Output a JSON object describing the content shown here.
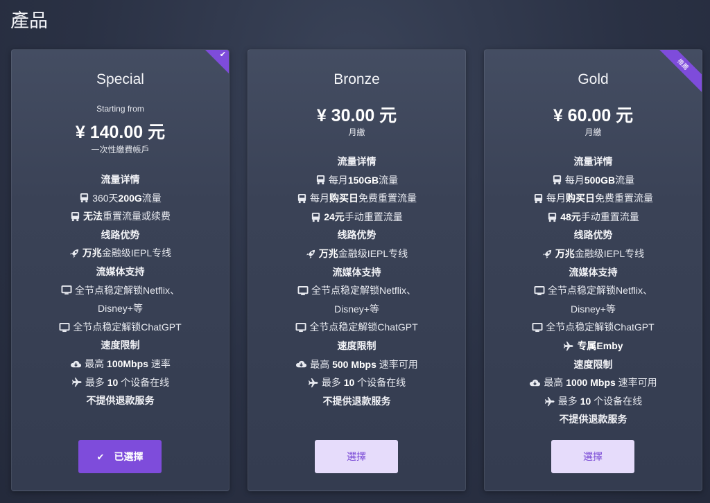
{
  "page": {
    "title": "產品"
  },
  "colors": {
    "accent": "#7e4cdb",
    "button_light": "#e6dcfb",
    "background": "#2a3144"
  },
  "plans": [
    {
      "name": "Special",
      "starting_label": "Starting from",
      "price": "¥ 140.00 元",
      "cycle": "一次性繳費帳戶",
      "button_label": "已選擇",
      "button_icon": "check-icon",
      "badge": "selected-check",
      "features": [
        {
          "text": "流量详情"
        },
        {
          "pre": "360天",
          "bold": "200G",
          "post": "流量"
        },
        {
          "bold": "无法",
          "post": "重置流量或续费"
        },
        {
          "text": "线路优势"
        },
        {
          "bold": "万兆",
          "post": "金融级IEPL专线"
        },
        {
          "text": "流媒体支持"
        },
        {
          "pre": "全节点稳定解锁Netflix、"
        },
        {
          "pre": "Disney+等"
        },
        {
          "pre": "全节点稳定解锁ChatGPT"
        },
        {
          "text": "速度限制"
        },
        {
          "pre": "最高 ",
          "bold": "100Mbps",
          "post": " 速率"
        },
        {
          "pre": "最多 ",
          "bold": "10",
          "post": " 个设备在线"
        },
        {
          "text": "不提供退款服务"
        }
      ]
    },
    {
      "name": "Bronze",
      "price": "¥ 30.00 元",
      "cycle": "月繳",
      "button_label": "選擇",
      "features": [
        {
          "text": "流量详情"
        },
        {
          "pre": "每月",
          "bold": "150GB",
          "post": "流量"
        },
        {
          "pre": "每月",
          "bold": "购买日",
          "post": "免费重置流量"
        },
        {
          "bold": "24元",
          "post": "手动重置流量"
        },
        {
          "text": "线路优势"
        },
        {
          "bold": "万兆",
          "post": "金融级IEPL专线"
        },
        {
          "text": "流媒体支持"
        },
        {
          "pre": "全节点稳定解锁Netflix、"
        },
        {
          "pre": "Disney+等"
        },
        {
          "pre": "全节点稳定解锁ChatGPT"
        },
        {
          "text": "速度限制"
        },
        {
          "pre": "最高 ",
          "bold": "500 Mbps",
          "post": " 速率可用"
        },
        {
          "pre": "最多 ",
          "bold": "10",
          "post": " 个设备在线"
        },
        {
          "text": "不提供退款服务"
        }
      ]
    },
    {
      "name": "Gold",
      "price": "¥ 60.00 元",
      "cycle": "月繳",
      "button_label": "選擇",
      "ribbon_label": "推薦",
      "features": [
        {
          "text": "流量详情"
        },
        {
          "pre": "每月",
          "bold": "500GB",
          "post": "流量"
        },
        {
          "pre": "每月",
          "bold": "购买日",
          "post": "免费重置流量"
        },
        {
          "bold": "48元",
          "post": "手动重置流量"
        },
        {
          "text": "线路优势"
        },
        {
          "bold": "万兆",
          "post": "金融级IEPL专线"
        },
        {
          "text": "流媒体支持"
        },
        {
          "pre": "全节点稳定解锁Netflix、"
        },
        {
          "pre": "Disney+等"
        },
        {
          "pre": "全节点稳定解锁ChatGPT"
        },
        {
          "bold": "专属Emby"
        },
        {
          "text": "速度限制"
        },
        {
          "pre": "最高 ",
          "bold": "1000 Mbps",
          "post": " 速率可用"
        },
        {
          "pre": "最多 ",
          "bold": "10",
          "post": " 个设备在线"
        },
        {
          "text": "不提供退款服务"
        }
      ]
    }
  ]
}
